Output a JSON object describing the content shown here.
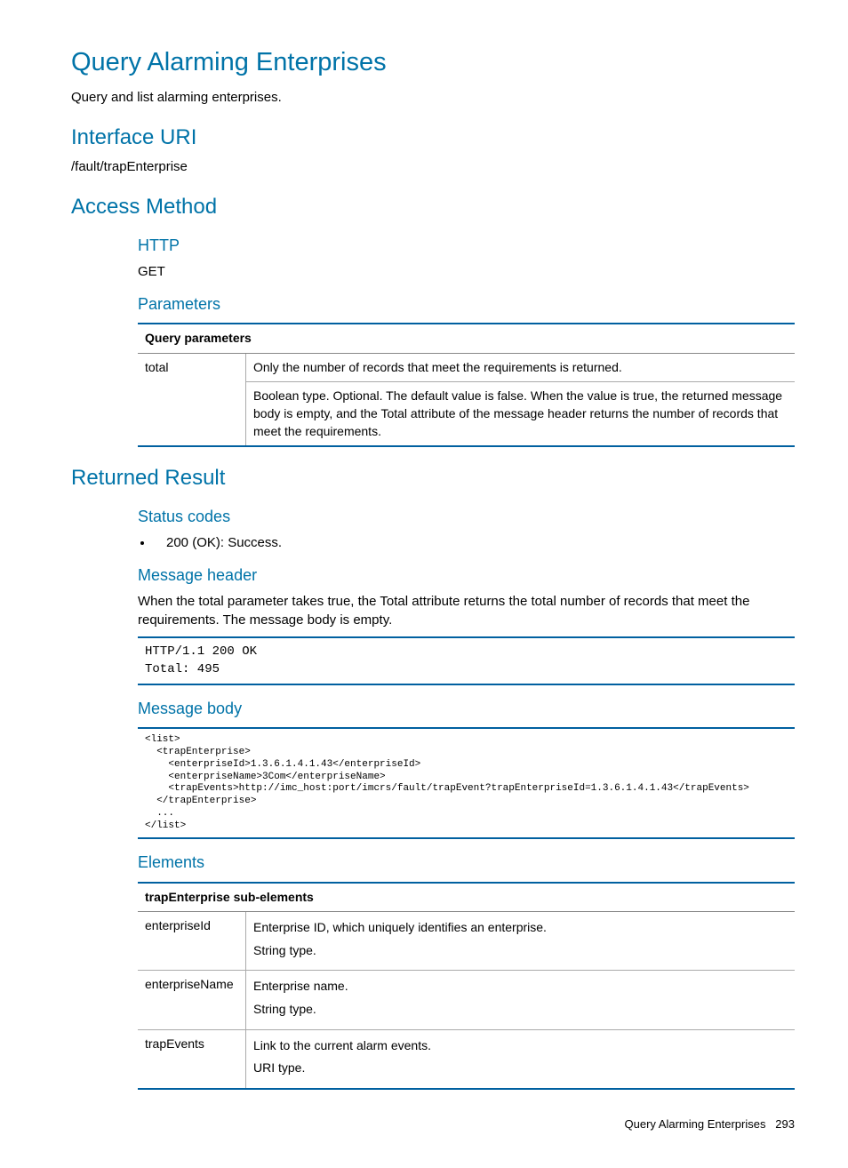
{
  "h1": "Query Alarming Enterprises",
  "intro": "Query and list alarming enterprises.",
  "interface": {
    "heading": "Interface URI",
    "uri": "/fault/trapEnterprise"
  },
  "access": {
    "heading": "Access Method",
    "http_label": "HTTP",
    "http_method": "GET",
    "params_label": "Parameters",
    "params_table": {
      "header": "Query parameters",
      "rows": [
        {
          "name": "total",
          "desc1": "Only the number of records that meet the requirements is returned.",
          "desc2": "Boolean type. Optional. The default value is false. When the value is true, the returned message body is empty, and the Total attribute of the message header returns the number of records that meet the requirements."
        }
      ]
    }
  },
  "returned": {
    "heading": "Returned Result",
    "status_codes_label": "Status codes",
    "status_item": "200 (OK): Success.",
    "msg_header_label": "Message header",
    "msg_header_text": "When the total parameter takes true, the Total attribute returns the total number of records that meet the requirements. The message body is empty.",
    "msg_header_code": "HTTP/1.1 200 OK\nTotal: 495",
    "msg_body_label": "Message body",
    "msg_body_code": "<list>\n  <trapEnterprise>\n    <enterpriseId>1.3.6.1.4.1.43</enterpriseId>\n    <enterpriseName>3Com</enterpriseName>\n    <trapEvents>http://imc_host:port/imcrs/fault/trapEvent?trapEnterpriseId=1.3.6.1.4.1.43</trapEvents>\n  </trapEnterprise>\n  ...\n</list>",
    "elements_label": "Elements",
    "elements_table": {
      "header": "trapEnterprise sub-elements",
      "rows": [
        {
          "name": "enterpriseId",
          "desc1": "Enterprise ID, which uniquely identifies an enterprise.",
          "desc2": "String type."
        },
        {
          "name": "enterpriseName",
          "desc1": "Enterprise name.",
          "desc2": "String type."
        },
        {
          "name": "trapEvents",
          "desc1": "Link to the current alarm events.",
          "desc2": "URI type."
        }
      ]
    }
  },
  "footer": {
    "title": "Query Alarming Enterprises",
    "page": "293"
  }
}
